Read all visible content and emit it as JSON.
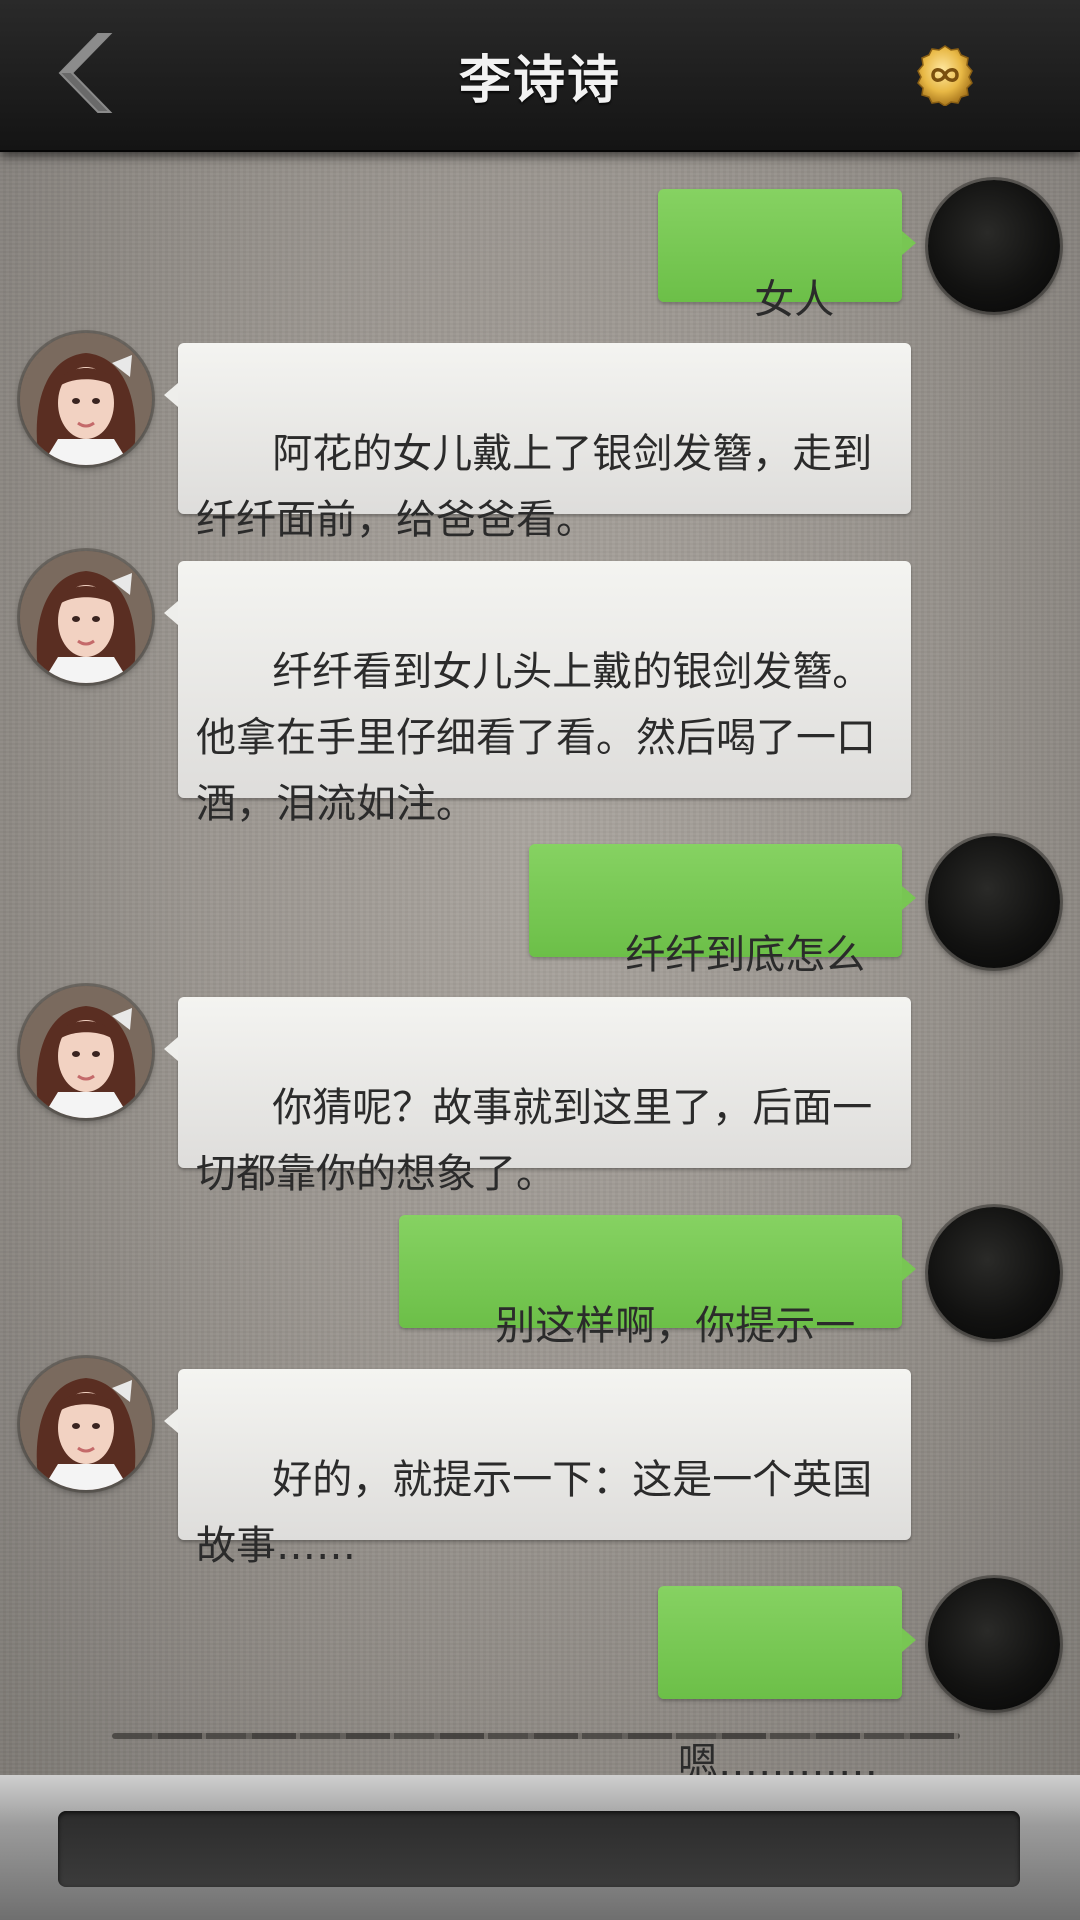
{
  "header": {
    "title": "李诗诗",
    "back_icon": "chevron-left-icon",
    "coin_icon": "infinity-coin-icon"
  },
  "messages": [
    {
      "sender": "me",
      "text": "女人啊……"
    },
    {
      "sender": "her",
      "text": "阿花的女儿戴上了银剑发簪，走到纤纤面前，给爸爸看。"
    },
    {
      "sender": "her",
      "text": "纤纤看到女儿头上戴的银剑发簪。他拿在手里仔细看了看。然后喝了一口酒，泪流如注。"
    },
    {
      "sender": "me",
      "text": "纤纤到底怎么了？"
    },
    {
      "sender": "her",
      "text": "你猜呢？故事就到这里了，后面一切都靠你的想象了。"
    },
    {
      "sender": "me",
      "text": "别这样啊，你提示一下！"
    },
    {
      "sender": "her",
      "text": "好的，就提示一下：这是一个英国故事……"
    },
    {
      "sender": "me",
      "text": "嗯…………"
    }
  ],
  "input": {
    "value": "",
    "placeholder": ""
  },
  "colors": {
    "header_bg": "#1c1c1c",
    "bubble_me": "#78c653",
    "bubble_her": "#ebebe8",
    "chat_bg": "#9b9690",
    "input_bg": "#333333"
  }
}
